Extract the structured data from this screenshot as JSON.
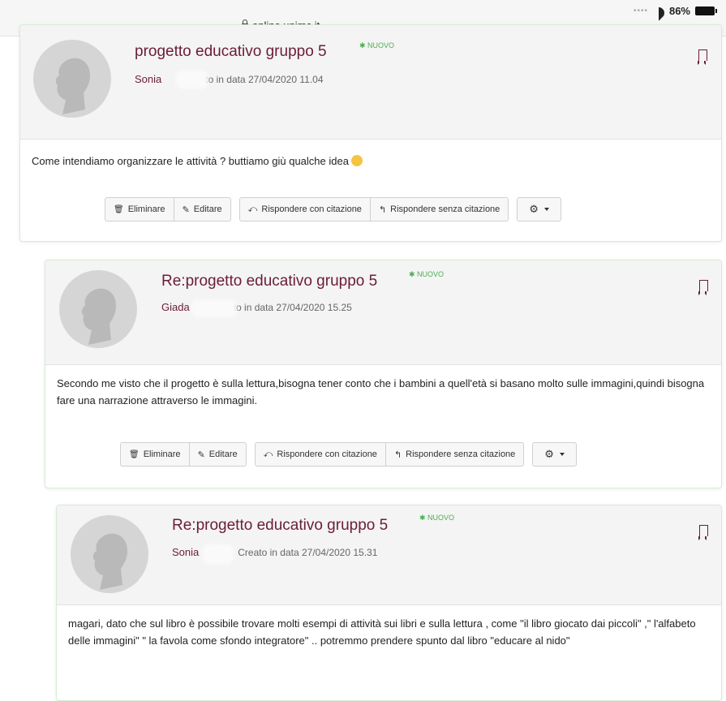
{
  "statusbar": {
    "url": "online.unimc.it",
    "battery": "86%"
  },
  "colors": {
    "accent": "#6b1d35",
    "new_badge": "#4caf50",
    "post_border": "#d6ecd3"
  },
  "posts": [
    {
      "subject": "progetto educativo gruppo 5",
      "badge": "✱ NUOVO",
      "author": "Sonia",
      "created": "Creato in data 27/04/2020 11.04",
      "body": "Come intendiamo organizzare le attività ? buttiamo giù qualche idea",
      "actions": {
        "delete": "Eliminare",
        "edit": "Editare",
        "reply_quote": "Rispondere con citazione",
        "reply_no_quote": "Rispondere senza citazione"
      }
    },
    {
      "subject": "Re:progetto educativo gruppo 5",
      "badge": "✱ NUOVO",
      "author": "Giada",
      "created": "Creato in data 27/04/2020 15.25",
      "body": "Secondo me visto che il progetto è sulla lettura,bisogna tener conto che i bambini a quell'età si basano molto sulle immagini,quindi bisogna fare una narrazione attraverso le immagini.",
      "actions": {
        "delete": "Eliminare",
        "edit": "Editare",
        "reply_quote": "Rispondere con citazione",
        "reply_no_quote": "Rispondere senza citazione"
      }
    },
    {
      "subject": "Re:progetto educativo gruppo 5",
      "badge": "✱ NUOVO",
      "author": "Sonia",
      "created": "Creato in data 27/04/2020 15.31",
      "body": "magari, dato che sul libro è possibile trovare molti esempi di attività sui libri e sulla lettura , come \"il libro giocato dai piccoli\" ,\" l'alfabeto delle immagini\" \" la favola come sfondo integratore\" .. potremmo prendere spunto dal libro \"educare al nido\""
    }
  ]
}
